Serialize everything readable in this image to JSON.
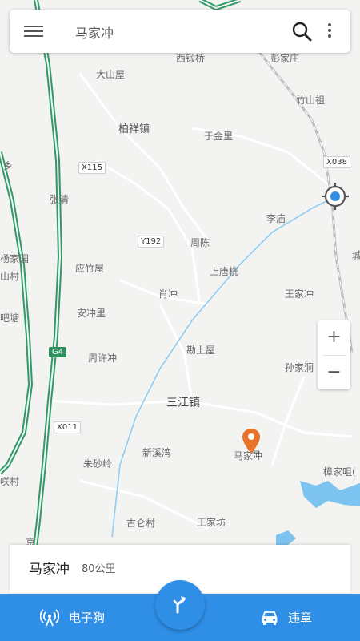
{
  "search": {
    "query": "马家冲"
  },
  "map": {
    "labels": {
      "xiduanqiao": "西锻桥",
      "pengjiazhuang": "彭家庄",
      "dashanwu": "大山屋",
      "zhushanzu": "竹山祖",
      "baixiangzhen": "柏祥镇",
      "yujinli": "于金里",
      "xiang": "乡",
      "zhangqing": "张清",
      "limiao": "李庙",
      "zhouchen": "周陈",
      "yangjiayuan": "杨家园",
      "shancun": "山村",
      "yingzhuwu": "应竹屋",
      "shangtanghe": "上唐桄",
      "xiaochong": "肖冲",
      "wangjiachong_n": "王家冲",
      "ditang": "吧塘",
      "anchongli": "安冲里",
      "zhouxuchong": "周许冲",
      "kanshangwu": "勘上屋",
      "sunjiadong": "孙家洞",
      "sanjiangzhen": "三江镇",
      "xinxiwan": "新溪湾",
      "majiachong": "马家冲",
      "zhushaling": "朱砂岭",
      "zhangjiaju": "樟家咀(",
      "xiancun": "咲村",
      "gulun": "古仑村",
      "wangjiafang": "王家坊",
      "jing": "京",
      "cheng": "城"
    },
    "roads": {
      "x115": "X115",
      "y192": "Y192",
      "x038": "X038",
      "g4": "G4",
      "x011": "X011"
    }
  },
  "controls": {
    "zoom_in": "+",
    "zoom_out": "−"
  },
  "destination": {
    "name": "马家冲",
    "distance": "80公里"
  },
  "bottom_bar": {
    "left_label": "电子狗",
    "right_label": "违章"
  },
  "colors": {
    "accent": "#2f8fe7",
    "pin": "#e8732a",
    "highway": "#2f8f5f",
    "water": "#7cc3f0"
  }
}
